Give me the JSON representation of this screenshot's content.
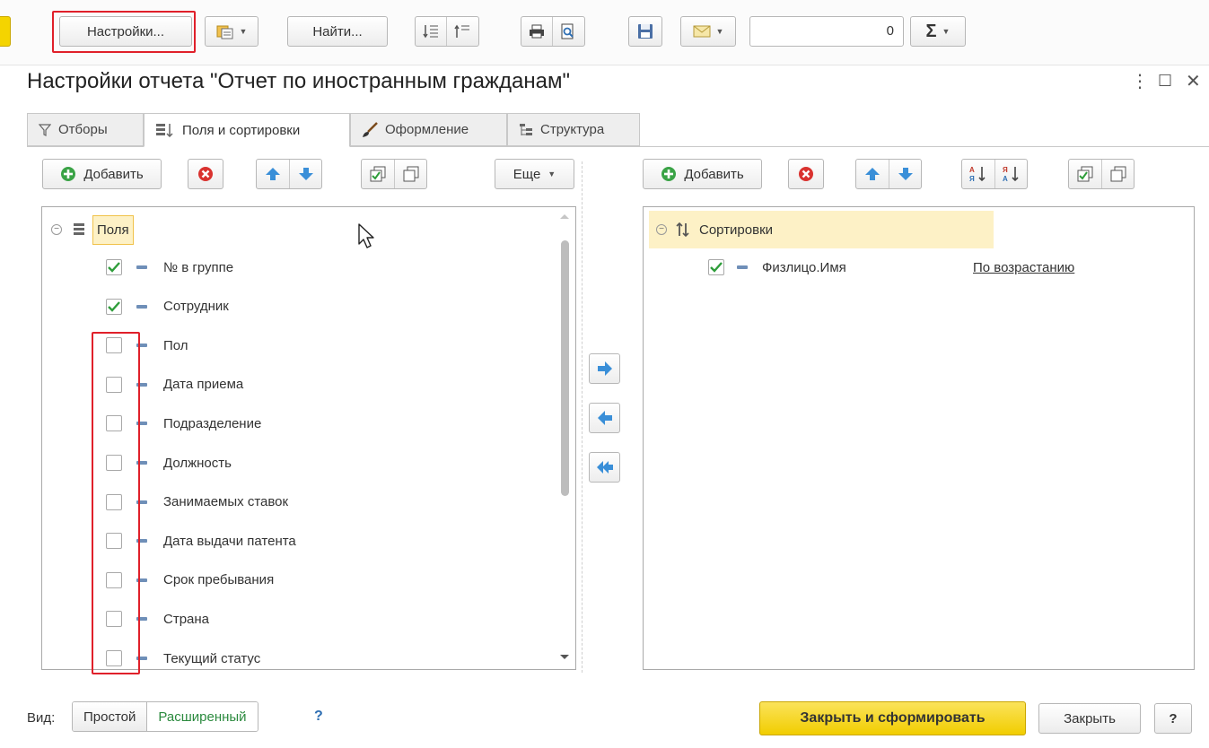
{
  "toolbar": {
    "settings_label": "Настройки...",
    "find_label": "Найти...",
    "counter_value": "0"
  },
  "window": {
    "title": "Настройки отчета \"Отчет по иностранным гражданам\"",
    "more_glyph": "⋮",
    "maximize_glyph": "☐",
    "close_glyph": "✕"
  },
  "tabs": [
    {
      "label": "Отборы",
      "icon": "filter-icon",
      "active": false
    },
    {
      "label": "Поля и сортировки",
      "icon": "fields-sort-icon",
      "active": true
    },
    {
      "label": "Оформление",
      "icon": "brush-icon",
      "active": false
    },
    {
      "label": "Структура",
      "icon": "structure-icon",
      "active": false
    }
  ],
  "left_panel": {
    "add_label": "Добавить",
    "more_label": "Еще",
    "root_label": "Поля",
    "fields": [
      {
        "label": "№ в группе",
        "checked": true
      },
      {
        "label": "Сотрудник",
        "checked": true
      },
      {
        "label": "Пол",
        "checked": false
      },
      {
        "label": "Дата приема",
        "checked": false
      },
      {
        "label": "Подразделение",
        "checked": false
      },
      {
        "label": "Должность",
        "checked": false
      },
      {
        "label": "Занимаемых ставок",
        "checked": false
      },
      {
        "label": "Дата выдачи патента",
        "checked": false
      },
      {
        "label": "Срок пребывания",
        "checked": false
      },
      {
        "label": "Страна",
        "checked": false
      },
      {
        "label": "Текущий статус",
        "checked": false
      }
    ]
  },
  "right_panel": {
    "add_label": "Добавить",
    "sort_asc_glyph": "А↓Я",
    "sort_desc_glyph": "Я↓А",
    "root_label": "Сортировки",
    "sortings": [
      {
        "field": "Физлицо.Имя",
        "direction": "По возрастанию",
        "checked": true
      }
    ]
  },
  "footer": {
    "view_label": "Вид:",
    "view_simple": "Простой",
    "view_extended": "Расширенный",
    "help_glyph": "?",
    "close_and_run_label": "Закрыть и сформировать",
    "close_label": "Закрыть",
    "help_button_label": "?"
  },
  "colors": {
    "accent_yellow": "#f1cd00",
    "highlight_red": "#e0202a",
    "check_green": "#2e9d3a",
    "arrow_blue": "#3a8fd8",
    "link_green": "#2b8a3e"
  }
}
